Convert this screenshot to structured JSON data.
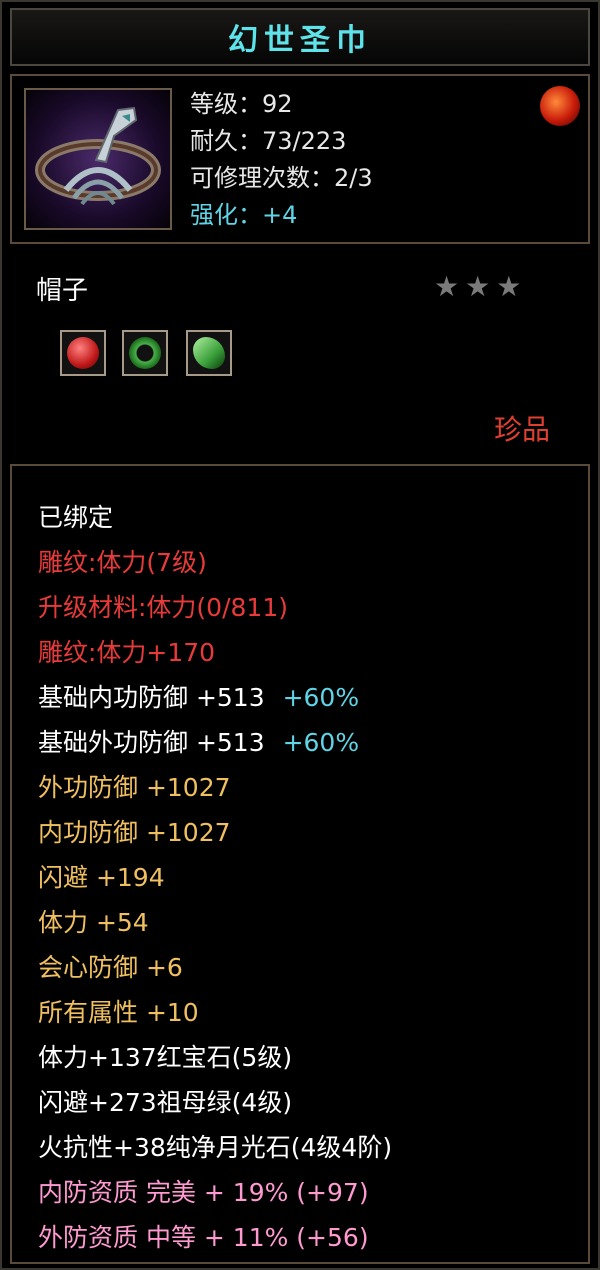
{
  "title": "幻世圣巾",
  "stats": {
    "level": "等级：92",
    "durability": "耐久：73/223",
    "repair": "可修理次数：2/3",
    "enhance": "强化：+4"
  },
  "item_type": "帽子",
  "stars": "★★★",
  "rarity": "珍品",
  "gems": [
    "ruby-gem-icon",
    "emerald-ring-gem-icon",
    "jade-gem-icon"
  ],
  "details": [
    {
      "text": "已绑定",
      "color": "white"
    },
    {
      "text": "雕纹:体力(7级)",
      "color": "red"
    },
    {
      "text": "升级材料:体力(0/811)",
      "color": "red"
    },
    {
      "text": "雕纹:体力+170",
      "color": "red"
    },
    {
      "text": "基础内功防御 +513",
      "extra": "+60%",
      "color": "white"
    },
    {
      "text": "基础外功防御 +513",
      "extra": "+60%",
      "color": "white"
    },
    {
      "text": "外功防御 +1027",
      "color": "gold"
    },
    {
      "text": "内功防御 +1027",
      "color": "gold"
    },
    {
      "text": "闪避 +194",
      "color": "gold"
    },
    {
      "text": "体力 +54",
      "color": "gold"
    },
    {
      "text": "会心防御 +6",
      "color": "gold"
    },
    {
      "text": "所有属性 +10",
      "color": "gold"
    },
    {
      "text": "体力+137红宝石(5级)",
      "color": "white"
    },
    {
      "text": "闪避+273祖母绿(4级)",
      "color": "white"
    },
    {
      "text": "火抗性+38纯净月光石(4级4阶)",
      "color": "white"
    },
    {
      "text": "内防资质 完美 + 19% (+97)",
      "color": "pink"
    },
    {
      "text": "外防资质 中等 + 11% (+56)",
      "color": "pink"
    }
  ]
}
